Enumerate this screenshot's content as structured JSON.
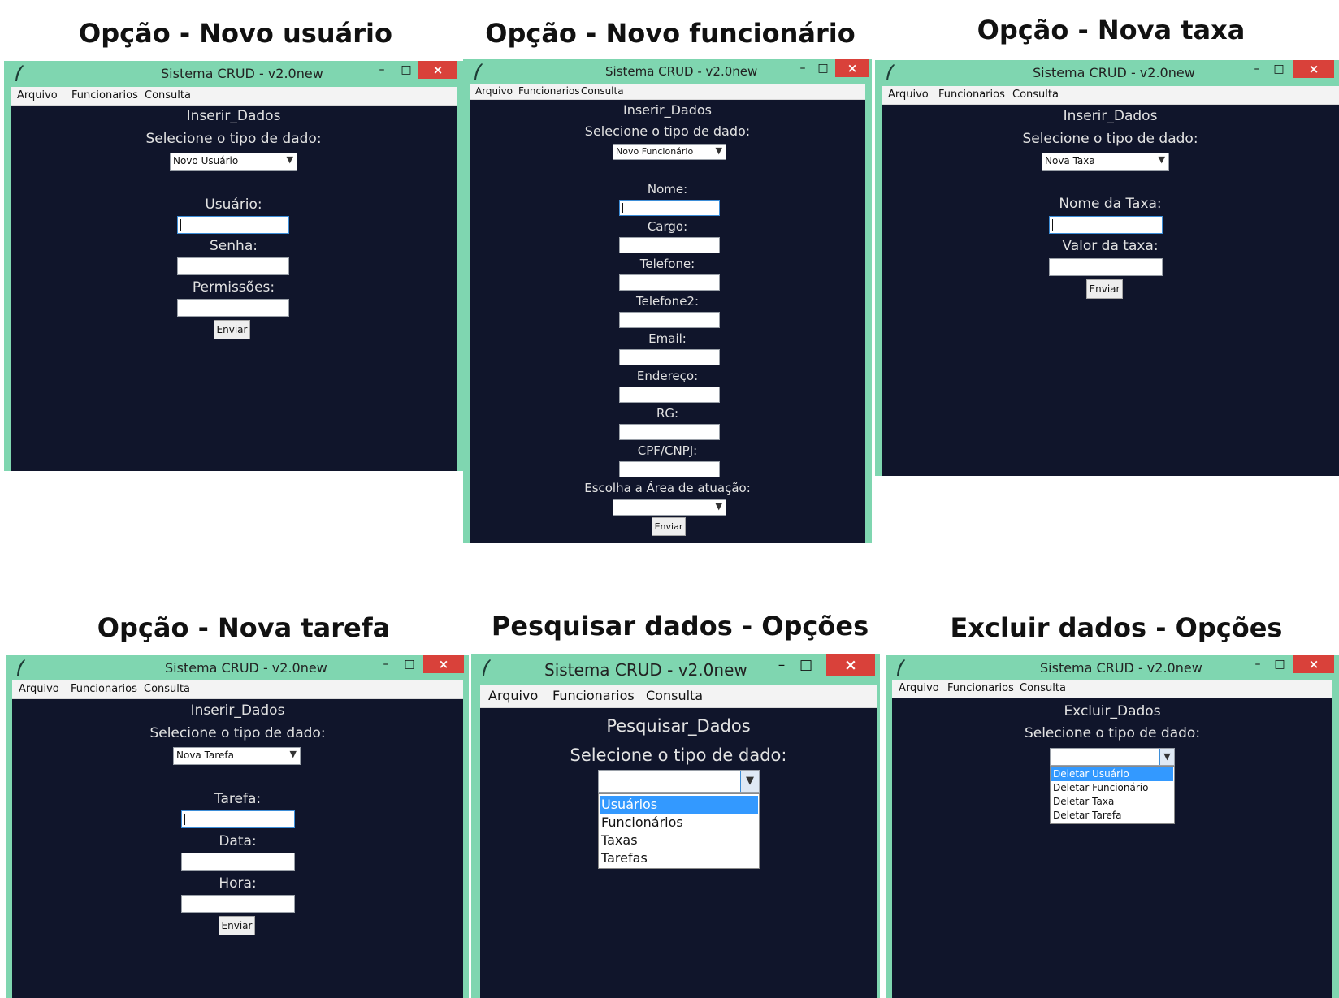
{
  "window_title": "Sistema CRUD - v2.0new",
  "menu": {
    "arquivo": "Arquivo",
    "funcionarios": "Funcionarios",
    "consulta": "Consulta"
  },
  "common": {
    "select_label": "Selecione o tipo de dado:",
    "submit": "Enviar",
    "minimize": "–",
    "maximize": "□",
    "close": "×"
  },
  "panels": {
    "usuario": {
      "caption": "Opção - Novo usuário",
      "heading": "Inserir_Dados",
      "selected": "Novo Usuário",
      "fields": [
        "Usuário:",
        "Senha:",
        "Permissões:"
      ]
    },
    "funcionario": {
      "caption": "Opção - Novo funcionário",
      "heading": "Inserir_Dados",
      "selected": "Novo Funcionário",
      "fields": [
        "Nome:",
        "Cargo:",
        "Telefone:",
        "Telefone2:",
        "Email:",
        "Endereço:",
        "RG:",
        "CPF/CNPJ:"
      ],
      "area_label": "Escolha a Área de atuação:"
    },
    "taxa": {
      "caption": "Opção - Nova taxa",
      "heading": "Inserir_Dados",
      "selected": "Nova Taxa",
      "fields": [
        "Nome da Taxa:",
        "Valor da taxa:"
      ]
    },
    "tarefa": {
      "caption": "Opção - Nova tarefa",
      "heading": "Inserir_Dados",
      "selected": "Nova Tarefa",
      "fields": [
        "Tarefa:",
        "Data:",
        "Hora:"
      ]
    },
    "pesquisar": {
      "caption": "Pesquisar dados - Opções",
      "heading": "Pesquisar_Dados",
      "options": [
        "Usuários",
        "Funcionários",
        "Taxas",
        "Tarefas"
      ]
    },
    "excluir": {
      "caption": "Excluir dados - Opções",
      "heading": "Excluir_Dados",
      "options": [
        "Deletar Usuário",
        "Deletar Funcionário",
        "Deletar Taxa",
        "Deletar Tarefa"
      ]
    }
  }
}
